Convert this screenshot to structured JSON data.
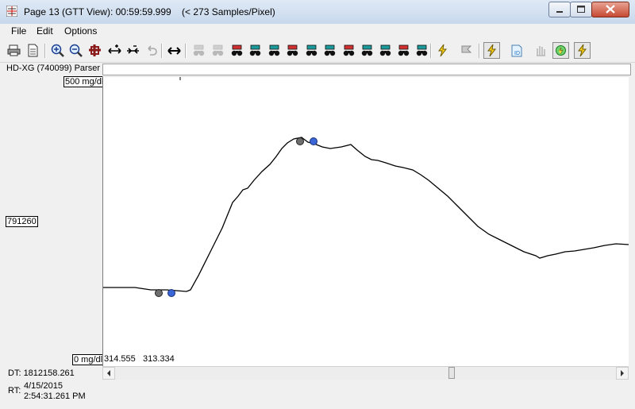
{
  "window": {
    "title": "Page 13 (GTT View): 00:59:59.999    (< 273 Samples/Pixel)"
  },
  "menu": [
    "File",
    "Edit",
    "Options"
  ],
  "toolbar": {
    "icons": [
      "print-icon",
      "page-setup-icon",
      "zoom-in-icon",
      "zoom-out-icon",
      "fit-icon",
      "expand-horizontal-icon",
      "compress-horizontal-icon",
      "undo-icon",
      "pan-horizontal-icon",
      "marker-icon",
      "marker-icon",
      "marker-icon",
      "marker-icon",
      "marker-icon",
      "marker-icon",
      "marker-icon",
      "marker-icon",
      "marker-icon",
      "marker-icon",
      "marker-icon",
      "marker-icon",
      "lightning-icon",
      "flag-icon",
      "lightning-icon",
      "id-icon",
      "hand-icon",
      "green-cycle-icon",
      "lightning-icon"
    ]
  },
  "parser": {
    "label": "HD-XG (740099) Parser",
    "value": ""
  },
  "axis": {
    "top_label": "500 mg/dl",
    "mid_label": "791260",
    "bottom_label": "0 mg/dl"
  },
  "readouts": {
    "left": "314.555",
    "right": "313.334"
  },
  "status": {
    "dt_label": "DT:",
    "dt_value": "1812158.261",
    "rt_label": "RT:",
    "rt_date": "4/15/2015",
    "rt_time": "2:54:31.261 PM"
  },
  "trace": {
    "color": "#000000",
    "marker_colors": {
      "gray": "#6e6e6e",
      "blue": "#3a66d6"
    }
  }
}
